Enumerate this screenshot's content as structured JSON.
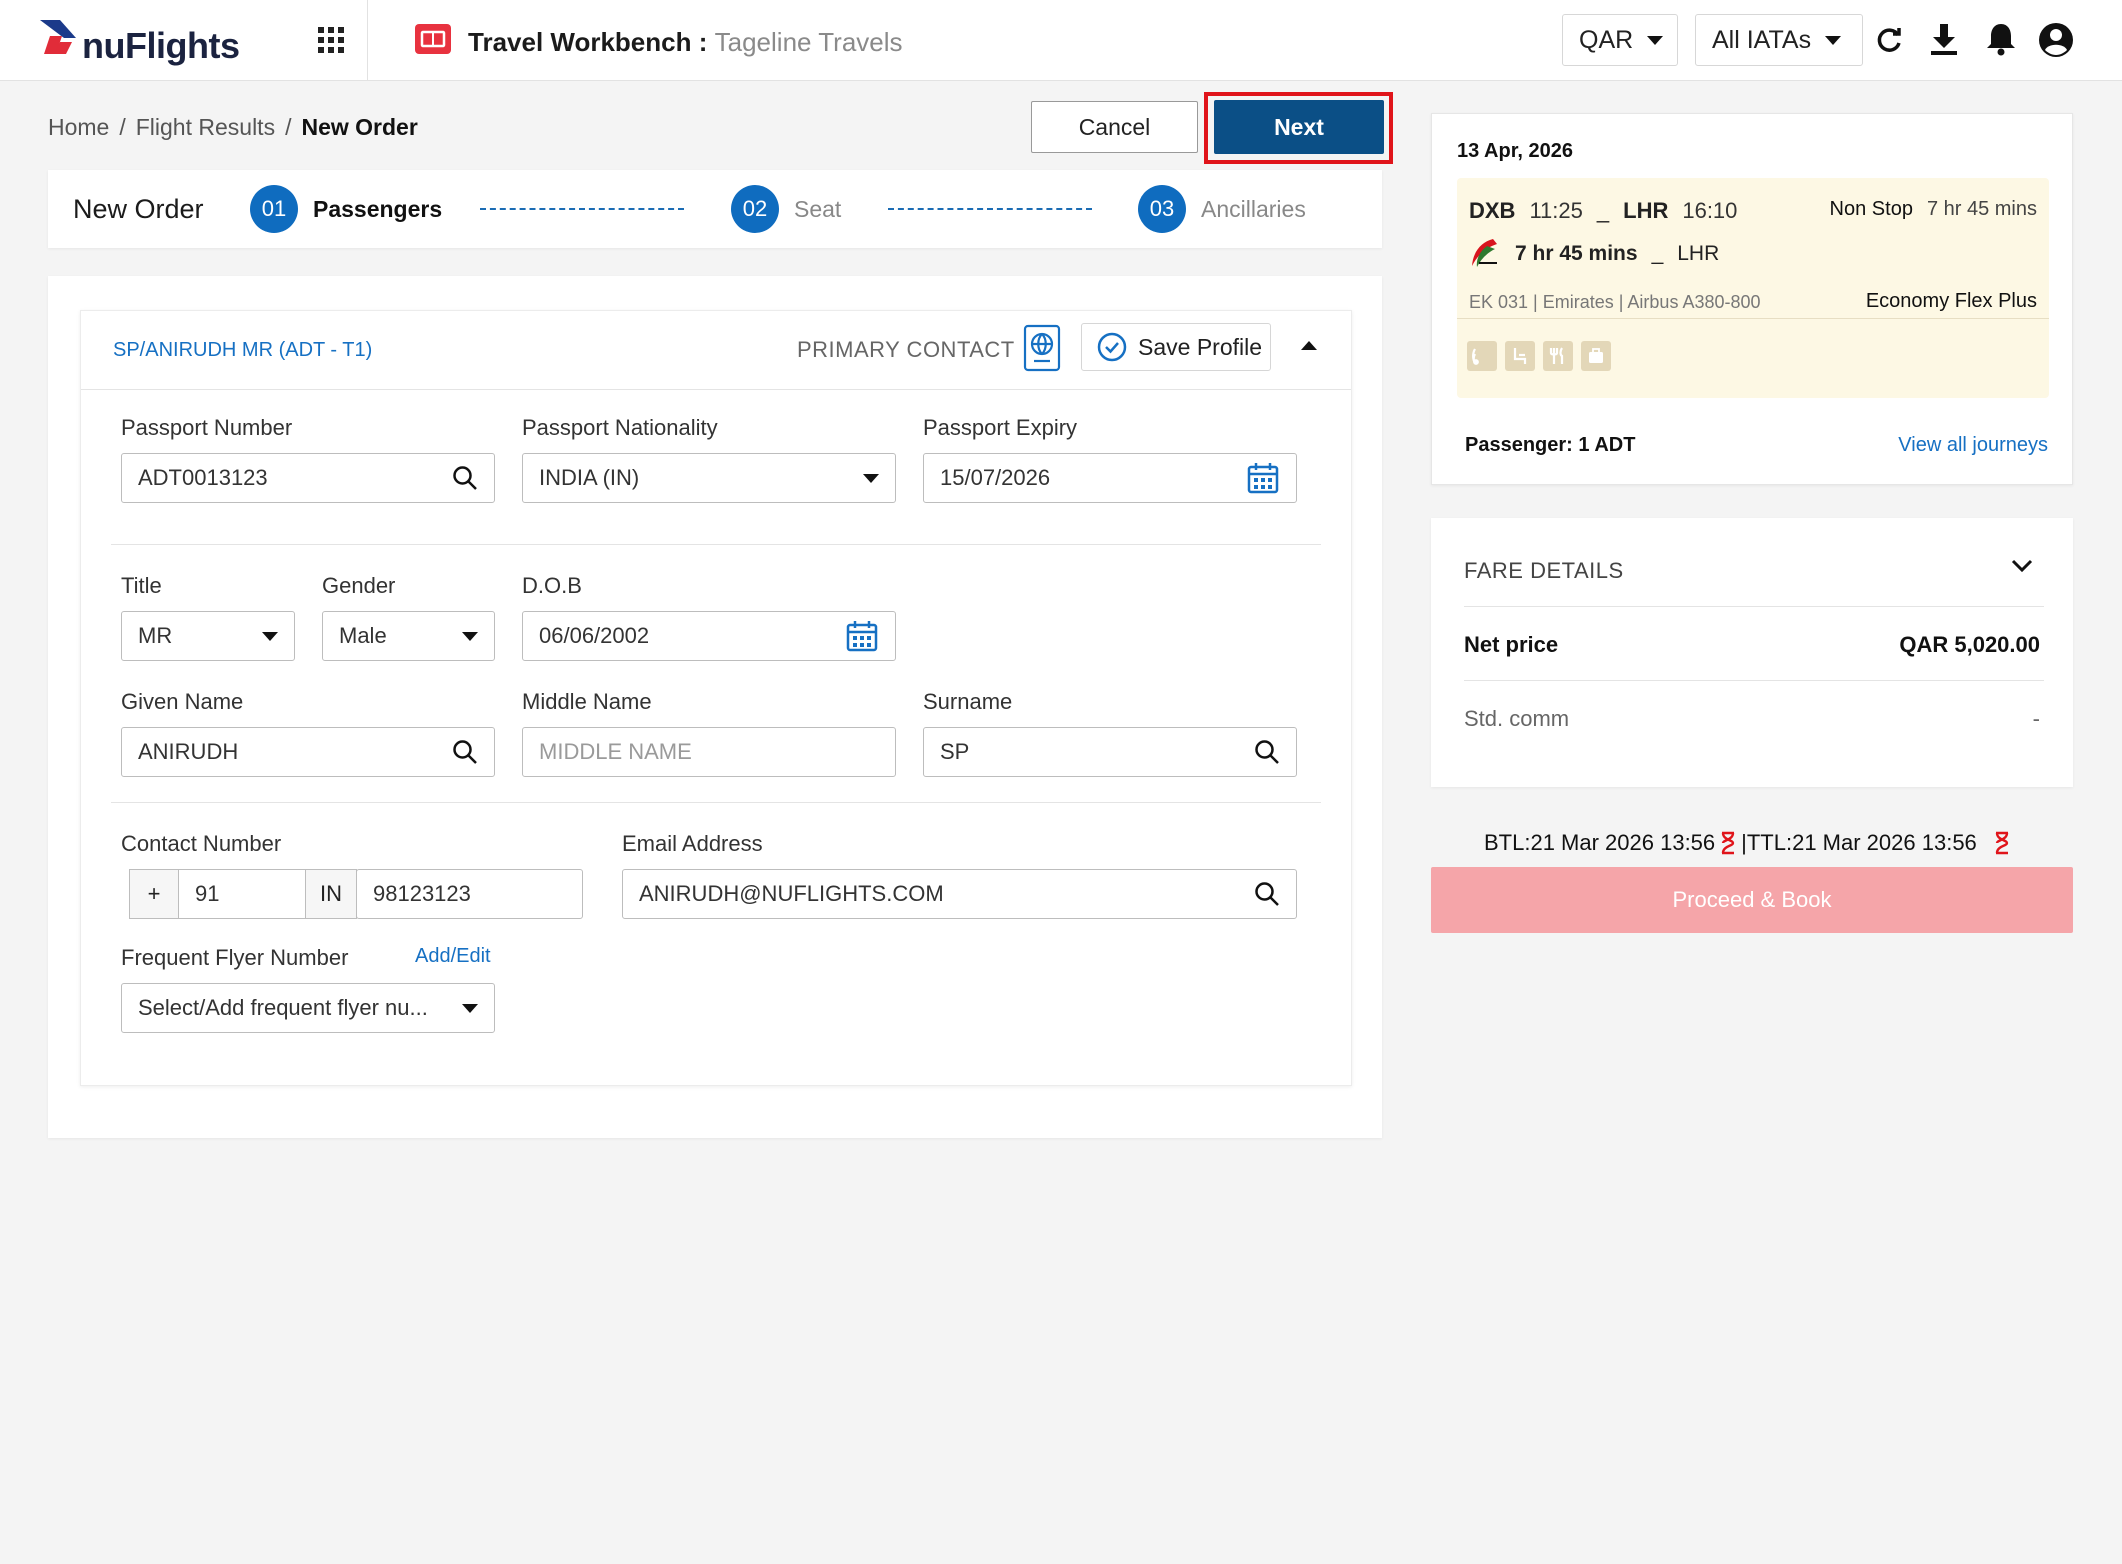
{
  "header": {
    "logo": "nuFlights",
    "title": "Travel Workbench",
    "separator": ":",
    "agency": "Tageline Travels",
    "currency": "QAR",
    "iata": "All IATAs"
  },
  "breadcrumb": {
    "home": "Home",
    "sep": "/",
    "results": "Flight Results",
    "current": "New Order"
  },
  "actions": {
    "cancel": "Cancel",
    "next": "Next"
  },
  "stepper": {
    "title": "New Order",
    "steps": [
      {
        "num": "01",
        "label": "Passengers"
      },
      {
        "num": "02",
        "label": "Seat"
      },
      {
        "num": "03",
        "label": "Ancillaries"
      }
    ]
  },
  "passenger": {
    "name": "SP/ANIRUDH MR (ADT - T1)",
    "primary_contact": "PRIMARY CONTACT",
    "save_profile": "Save Profile",
    "passport_number_label": "Passport Number",
    "passport_number": "ADT0013123",
    "nationality_label": "Passport Nationality",
    "nationality": "INDIA (IN)",
    "expiry_label": "Passport Expiry",
    "expiry": "15/07/2026",
    "title_label": "Title",
    "title": "MR",
    "gender_label": "Gender",
    "gender": "Male",
    "dob_label": "D.O.B",
    "dob": "06/06/2002",
    "given_label": "Given Name",
    "given": "ANIRUDH",
    "middle_label": "Middle Name",
    "middle_placeholder": "MIDDLE NAME",
    "surname_label": "Surname",
    "surname": "SP",
    "contact_label": "Contact Number",
    "contact_plus": "+",
    "contact_code": "91",
    "contact_country": "IN",
    "contact_number": "98123123",
    "email_label": "Email Address",
    "email": "ANIRUDH@NUFLIGHTS.COM",
    "ff_label": "Frequent Flyer Number",
    "ff_add": "Add/Edit",
    "ff_placeholder": "Select/Add frequent flyer nu..."
  },
  "itinerary": {
    "date": "13 Apr, 2026",
    "origin": "DXB",
    "dep_time": "11:25",
    "dash": "_",
    "destination": "LHR",
    "arr_time": "16:10",
    "stops": "Non Stop",
    "duration": "7 hr 45 mins",
    "duration2": "7 hr 45 mins",
    "dest2": "LHR",
    "flight_info": "EK 031 | Emirates | Airbus A380-800",
    "cabin": "Economy Flex Plus",
    "passenger": "Passenger: 1 ADT",
    "view_all": "View all journeys"
  },
  "fare": {
    "title": "FARE DETAILS",
    "net_label": "Net price",
    "net_value": "QAR 5,020.00",
    "comm_label": "Std. comm",
    "comm_value": "-"
  },
  "timelimits": {
    "btl": "BTL:21 Mar 2026 13:56",
    "ttl": "|TTL:21 Mar 2026 13:56"
  },
  "proceed": "Proceed & Book",
  "colors": {
    "primary": "#0b4f86",
    "link": "#1670c3",
    "highlight": "#e0141a",
    "proceed": "#f5a5a9"
  }
}
